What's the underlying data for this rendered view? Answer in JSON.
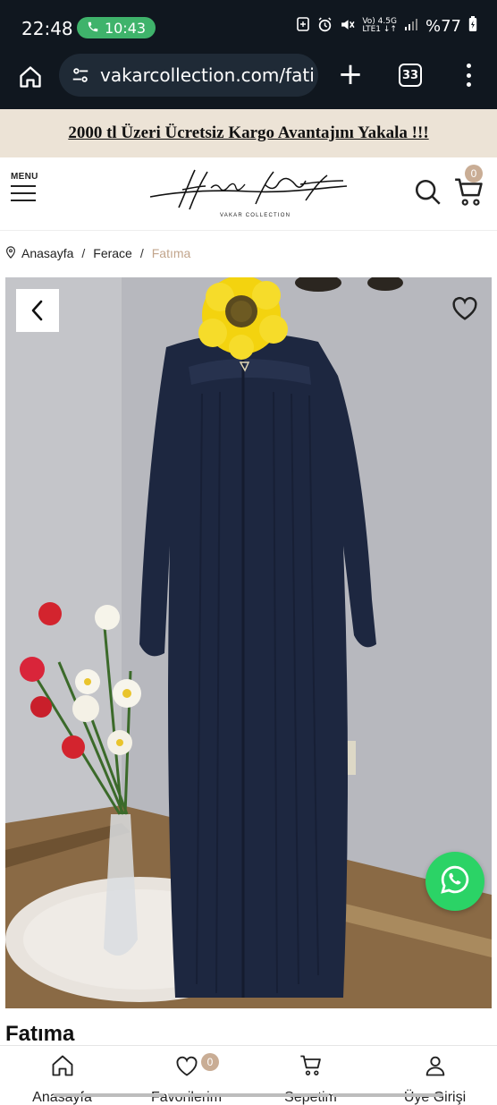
{
  "status_bar": {
    "time": "22:48",
    "call_time": "10:43",
    "network_top": "Vo) 4.5G",
    "network_bottom": "LTE1 ↓↑",
    "battery": "%77"
  },
  "browser": {
    "url": "vakarcollection.com/fati",
    "tab_count": "33"
  },
  "promo": {
    "text": "2000 tl Üzeri Ücretsiz Kargo Avantajını Yakala !!!"
  },
  "header": {
    "menu_label": "MENU",
    "logo_caption": "VAKAR COLLECTION",
    "cart_count": "0"
  },
  "breadcrumb": {
    "home": "Anasayfa",
    "category": "Ferace",
    "current": "Fatıma"
  },
  "product": {
    "title": "Fatıma"
  },
  "bottom_nav": {
    "home_label": "Anasayfa",
    "favorites_label": "Favorilerim",
    "favorites_count": "0",
    "cart_label": "Sepetim",
    "account_label": "Üye Girişi"
  },
  "colors": {
    "browser_bg": "#10171f",
    "promo_bg": "#ece3d6",
    "accent": "#c9ad95",
    "whatsapp": "#2bd366",
    "garment": "#1d2740"
  }
}
